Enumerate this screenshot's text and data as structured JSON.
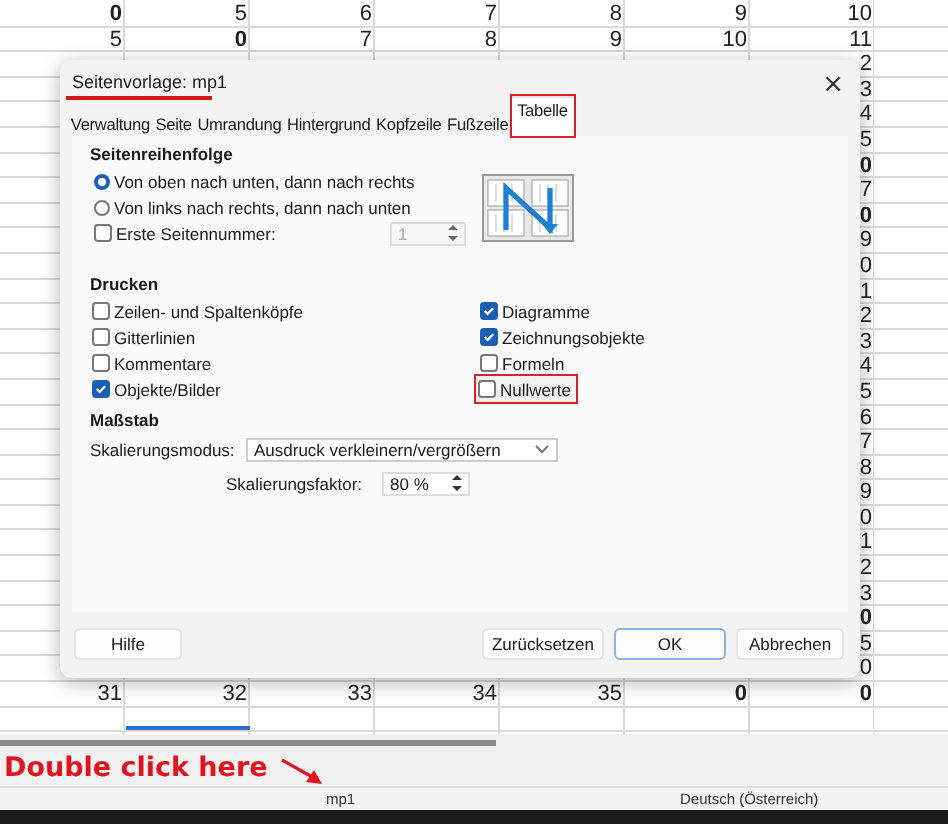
{
  "sheet": {
    "top_rows": [
      {
        "cells": [
          {
            "text": "0",
            "bold": true
          },
          {
            "text": "5",
            "bold": false
          },
          {
            "text": "6",
            "bold": false
          },
          {
            "text": "7",
            "bold": false
          },
          {
            "text": "8",
            "bold": false
          },
          {
            "text": "9",
            "bold": false
          },
          {
            "text": "10",
            "bold": false
          }
        ]
      },
      {
        "cells": [
          {
            "text": "5",
            "bold": false
          },
          {
            "text": "0",
            "bold": true
          },
          {
            "text": "7",
            "bold": false
          },
          {
            "text": "8",
            "bold": false
          },
          {
            "text": "9",
            "bold": false
          },
          {
            "text": "10",
            "bold": false
          },
          {
            "text": "11",
            "bold": false
          }
        ]
      }
    ],
    "column_7": {
      "cells": [
        {
          "text": "2",
          "bold": false
        },
        {
          "text": "3",
          "bold": false
        },
        {
          "text": "4",
          "bold": false
        },
        {
          "text": "5",
          "bold": false
        },
        {
          "text": "0",
          "bold": true
        },
        {
          "text": "7",
          "bold": false
        },
        {
          "text": "0",
          "bold": true
        },
        {
          "text": "9",
          "bold": false
        },
        {
          "text": "0",
          "bold": false
        },
        {
          "text": "1",
          "bold": false
        },
        {
          "text": "2",
          "bold": false
        },
        {
          "text": "3",
          "bold": false
        },
        {
          "text": "4",
          "bold": false
        },
        {
          "text": "5",
          "bold": false
        },
        {
          "text": "6",
          "bold": false
        },
        {
          "text": "7",
          "bold": false
        },
        {
          "text": "8",
          "bold": false
        },
        {
          "text": "9",
          "bold": false
        },
        {
          "text": "0",
          "bold": false
        },
        {
          "text": "1",
          "bold": false
        },
        {
          "text": "2",
          "bold": false
        },
        {
          "text": "3",
          "bold": false
        },
        {
          "text": "0",
          "bold": true
        },
        {
          "text": "5",
          "bold": false
        },
        {
          "text": "0",
          "bold": false
        }
      ]
    },
    "bottom_row": {
      "cells": [
        {
          "text": "31",
          "bold": false
        },
        {
          "text": "32",
          "bold": false
        },
        {
          "text": "33",
          "bold": false
        },
        {
          "text": "34",
          "bold": false
        },
        {
          "text": "35",
          "bold": false
        },
        {
          "text": "0",
          "bold": true
        },
        {
          "text": "0",
          "bold": true
        }
      ]
    }
  },
  "dialog": {
    "title": "Seitenvorlage: mp1",
    "title_annotated": true,
    "close": "×",
    "tabs": [
      {
        "label": "Verwaltung",
        "selected": false,
        "annotated": false
      },
      {
        "label": "Seite",
        "selected": false,
        "annotated": false
      },
      {
        "label": "Umrandung",
        "selected": false,
        "annotated": false
      },
      {
        "label": "Hintergrund",
        "selected": false,
        "annotated": false
      },
      {
        "label": "Kopfzeile",
        "selected": false,
        "annotated": false
      },
      {
        "label": "Fußzeile",
        "selected": false,
        "annotated": false
      },
      {
        "label": "Tabelle",
        "selected": true,
        "annotated": true
      }
    ],
    "page_order": {
      "heading": "Seitenreihenfolge",
      "options": [
        {
          "label": "Von oben nach unten, dann nach rechts",
          "selected": true
        },
        {
          "label": "Von links nach rechts, dann nach unten",
          "selected": false
        }
      ],
      "first_page_number": {
        "label": "Erste Seitennummer:",
        "checked": false,
        "value": "1",
        "disabled": true
      }
    },
    "print": {
      "heading": "Drucken",
      "options": [
        {
          "label": "Zeilen- und Spaltenköpfe",
          "checked": false,
          "annotated": false
        },
        {
          "label": "Gitterlinien",
          "checked": false,
          "annotated": false
        },
        {
          "label": "Kommentare",
          "checked": false,
          "annotated": false
        },
        {
          "label": "Objekte/Bilder",
          "checked": true,
          "annotated": false
        },
        {
          "label": "Diagramme",
          "checked": true,
          "annotated": false
        },
        {
          "label": "Zeichnungsobjekte",
          "checked": true,
          "annotated": false
        },
        {
          "label": "Formeln",
          "checked": false,
          "annotated": false
        },
        {
          "label": "Nullwerte",
          "checked": false,
          "annotated": true
        }
      ]
    },
    "scale": {
      "heading": "Maßstab",
      "mode_label": "Skalierungsmodus:",
      "mode_value": "Ausdruck verkleinern/vergrößern",
      "factor_label": "Skalierungsfaktor:",
      "factor_value": "80 %"
    },
    "buttons": [
      {
        "label": "Hilfe",
        "kind": "help"
      },
      {
        "label": "Zurücksetzen",
        "kind": "normal"
      },
      {
        "label": "OK",
        "kind": "default"
      },
      {
        "label": "Abbrechen",
        "kind": "normal"
      }
    ]
  },
  "annotation": {
    "text": "Double click here"
  },
  "status_bar": {
    "page_style": "mp1",
    "language": "Deutsch (Österreich)"
  }
}
